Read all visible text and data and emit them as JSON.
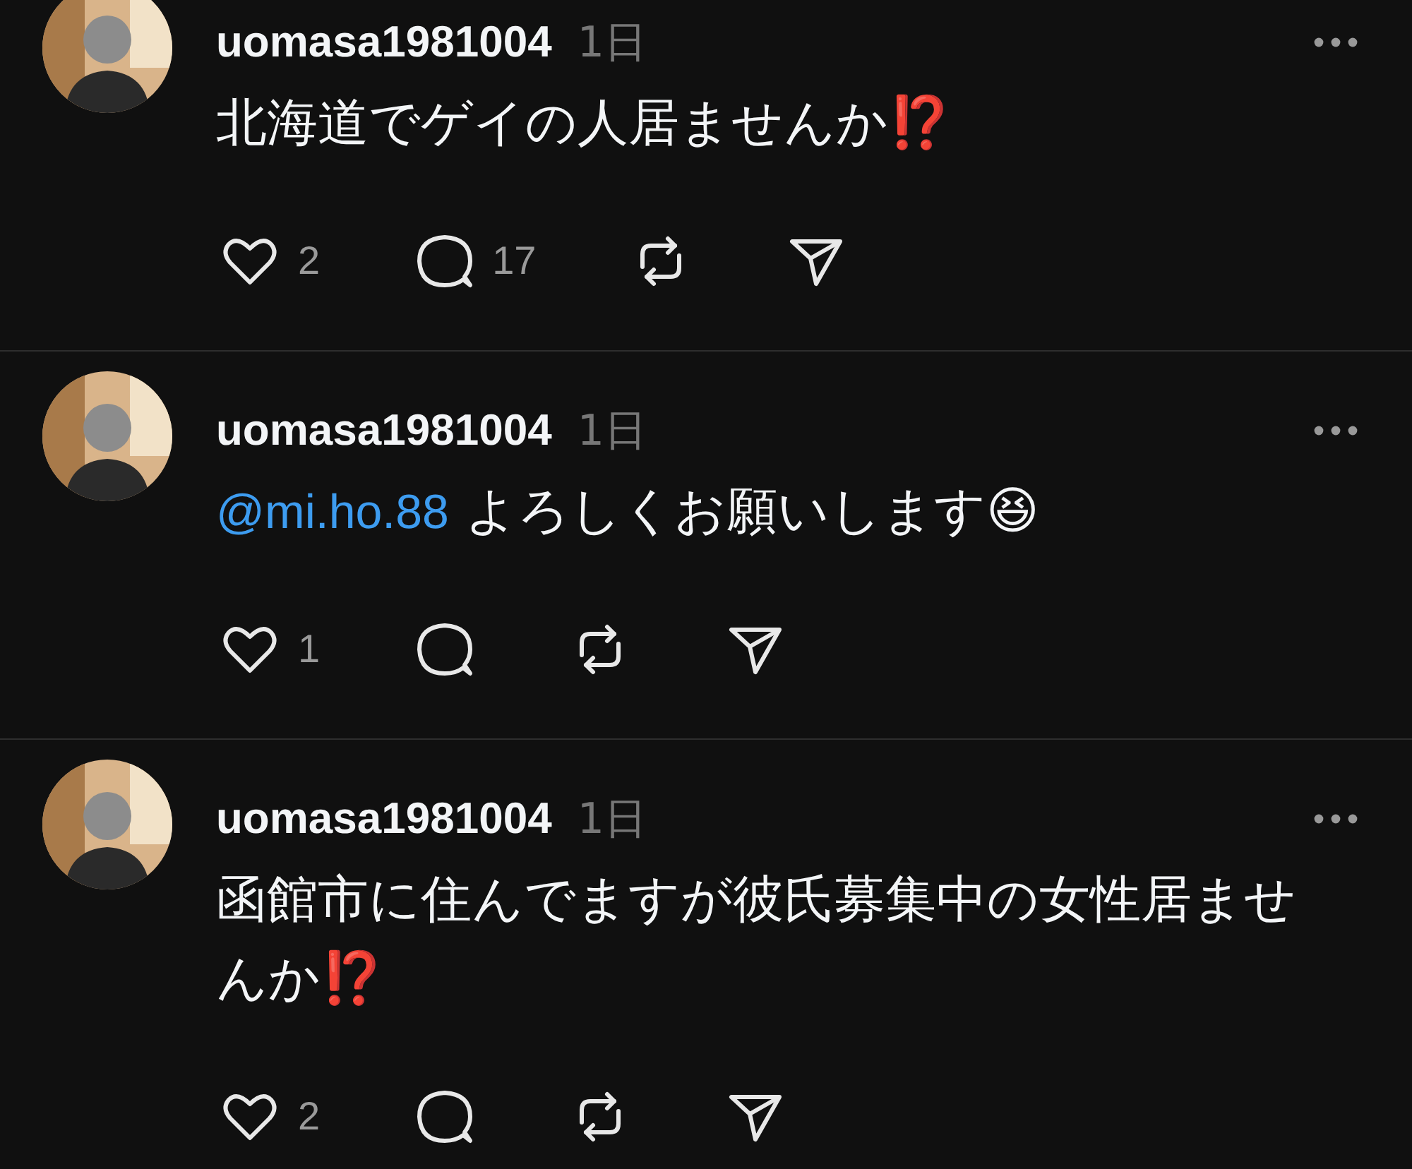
{
  "posts": [
    {
      "username": "uomasa1981004",
      "time": "1日",
      "text": "北海道でゲイの人居ませんか⁉️",
      "likes": "2",
      "replies": "17"
    },
    {
      "username": "uomasa1981004",
      "time": "1日",
      "mention": "@mi.ho.88",
      "text": "よろしくお願いします😆",
      "likes": "1"
    },
    {
      "username": "uomasa1981004",
      "time": "1日",
      "text": "函館市に住んでますが彼氏募集中の女性居ませんか⁉️",
      "likes": "2"
    }
  ]
}
